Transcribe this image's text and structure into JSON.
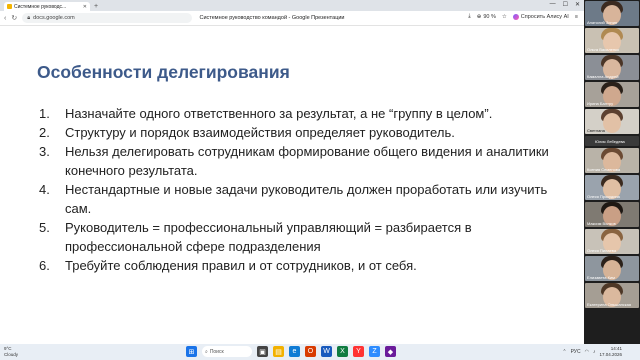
{
  "browser": {
    "tab_title": "Системное руководс...",
    "url": "docs.google.com",
    "page_title": "Системное руководство командой - Google Презентации",
    "zoom": "90 %",
    "alice_label": "Спросить Алису AI"
  },
  "slide": {
    "title": "Особенности делегирования",
    "items": [
      {
        "num": "1.",
        "text": "Назначайте одного ответственного за результат, а не “группу в целом”."
      },
      {
        "num": "2.",
        "text": "Структуру и порядок взаимодействия определяет руководитель."
      },
      {
        "num": "3.",
        "text": "Нельзя делегировать сотрудникам формирование общего видения и аналитики конечного результата."
      },
      {
        "num": "4.",
        "text": "Нестандартные и новые задачи руководитель должен проработать или изучить сам."
      },
      {
        "num": "5.",
        "text": "Руководитель = профессиональный управляющий = разбирается в профессиональной сфере подразделения"
      },
      {
        "num": "6.",
        "text": "Требуйте соблюдения правил и от сотрудников, и от себя."
      }
    ]
  },
  "participants": [
    {
      "name": "Анатолий Зинин"
    },
    {
      "name": "Ольга Василенко"
    },
    {
      "name": "Камалла Андрей"
    },
    {
      "name": "Ирина Балтру"
    },
    {
      "name": "Светлана"
    },
    {
      "name": "Юлия Лебедева"
    },
    {
      "name": "Ксения Семенова"
    },
    {
      "name": "Олеся Прокудина"
    },
    {
      "name": "Максим Волков"
    },
    {
      "name": "Олеся Пилаева"
    },
    {
      "name": "Елизавета Ким"
    },
    {
      "name": "Екатерина Ольшанская"
    }
  ],
  "taskbar": {
    "weather_temp": "9°C",
    "weather_desc": "Cloudy",
    "search_label": "Поиск",
    "lang": "РУС",
    "time": "14:41",
    "date": "17.04.2026"
  }
}
